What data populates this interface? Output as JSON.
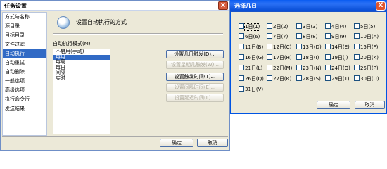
{
  "left_window": {
    "title": "任务设置",
    "close_glyph": "X",
    "nav": [
      "方式与名称",
      "源目录",
      "目标目录",
      "文件过滤",
      "自动执行",
      "自动重试",
      "自动删除",
      "一般选项",
      "高级选项",
      "执行命令行",
      "发送结果"
    ],
    "nav_selected_index": 4,
    "header_title": "设置自动执行的方式",
    "mode_label": "自动执行模式(M)",
    "modes": [
      "不启用(手动)",
      "每月",
      "每周",
      "每日",
      "间隔",
      "实时"
    ],
    "mode_selected_index": 1,
    "buttons": {
      "set_days": "设置几日触发(D)...",
      "set_weekdays": "设置星期几触发(W)...",
      "set_trigger_time": "设置触发时间(T)...",
      "set_interval": "设置间隔时间(E)...",
      "set_delay": "设置延迟时间(L)..."
    },
    "ok": "确定",
    "cancel": "取消"
  },
  "right_window": {
    "title": "选择几日",
    "close_glyph": "X",
    "days": [
      "1日(1)",
      "2日(2)",
      "3日(3)",
      "4日(4)",
      "5日(5)",
      "6日(6)",
      "7日(7)",
      "8日(8)",
      "9日(9)",
      "10日(A)",
      "11日(B)",
      "12日(C)",
      "13日(D)",
      "14日(E)",
      "15日(F)",
      "16日(G)",
      "17日(H)",
      "18日(I)",
      "19日(J)",
      "20日(K)",
      "21日(L)",
      "22日(M)",
      "23日(N)",
      "24日(O)",
      "25日(P)",
      "26日(Q)",
      "27日(R)",
      "28日(S)",
      "29日(T)",
      "30日(U)",
      "31日(V)"
    ],
    "focused_index": 0,
    "ok": "确定",
    "cancel": "取消"
  }
}
